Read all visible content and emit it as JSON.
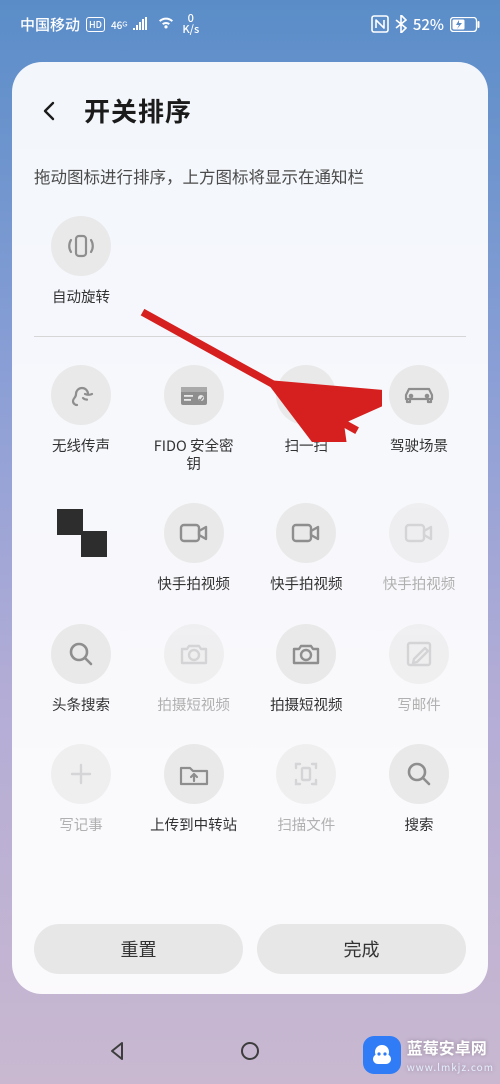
{
  "status": {
    "carrier": "中国移动",
    "hd_badge": "HD",
    "net_badge": "46",
    "speed_top": "0",
    "speed_bot": "K/s",
    "battery_pct": "52%"
  },
  "header": {
    "title": "开关排序"
  },
  "instruction": "拖动图标进行排序，上方图标将显示在通知栏",
  "row1": [
    {
      "name": "auto-rotate",
      "label": "自动旋转",
      "icon": "rotate"
    }
  ],
  "row2": [
    {
      "name": "wireless-sound",
      "label": "无线传声",
      "icon": "ear"
    },
    {
      "name": "fido-key",
      "label": "FIDO 安全密钥",
      "icon": "id-card"
    },
    {
      "name": "scan",
      "label": "扫一扫",
      "icon": "frame"
    },
    {
      "name": "drive",
      "label": "驾驶场景",
      "icon": "car"
    }
  ],
  "row3": [
    {
      "name": "redacted",
      "label": "　　",
      "redacted": true
    },
    {
      "name": "kuaishou-video-1",
      "label": "快手拍视频",
      "icon": "video"
    },
    {
      "name": "kuaishou-video-2",
      "label": "快手拍视频",
      "icon": "video"
    },
    {
      "name": "kuaishou-video-3",
      "label": "快手拍视频",
      "icon": "video",
      "disabled": true
    }
  ],
  "row4": [
    {
      "name": "toutiao-search",
      "label": "头条搜索",
      "icon": "search"
    },
    {
      "name": "shoot-short-1",
      "label": "拍摄短视频",
      "icon": "camera",
      "dim": true
    },
    {
      "name": "shoot-short-2",
      "label": "拍摄短视频",
      "icon": "camera"
    },
    {
      "name": "write-mail",
      "label": "写邮件",
      "icon": "compose",
      "dim": true
    }
  ],
  "row5": [
    {
      "name": "write-note",
      "label": "写记事",
      "icon": "plus",
      "dim": true
    },
    {
      "name": "upload-relay",
      "label": "上传到中转站",
      "icon": "upload-folder"
    },
    {
      "name": "scan-doc",
      "label": "扫描文件",
      "icon": "doc-frame",
      "dim": true
    },
    {
      "name": "search",
      "label": "搜索",
      "icon": "search"
    }
  ],
  "footer": {
    "reset": "重置",
    "done": "完成"
  },
  "watermark": {
    "title": "蓝莓安卓网",
    "url": "www.lmkjz.com"
  }
}
